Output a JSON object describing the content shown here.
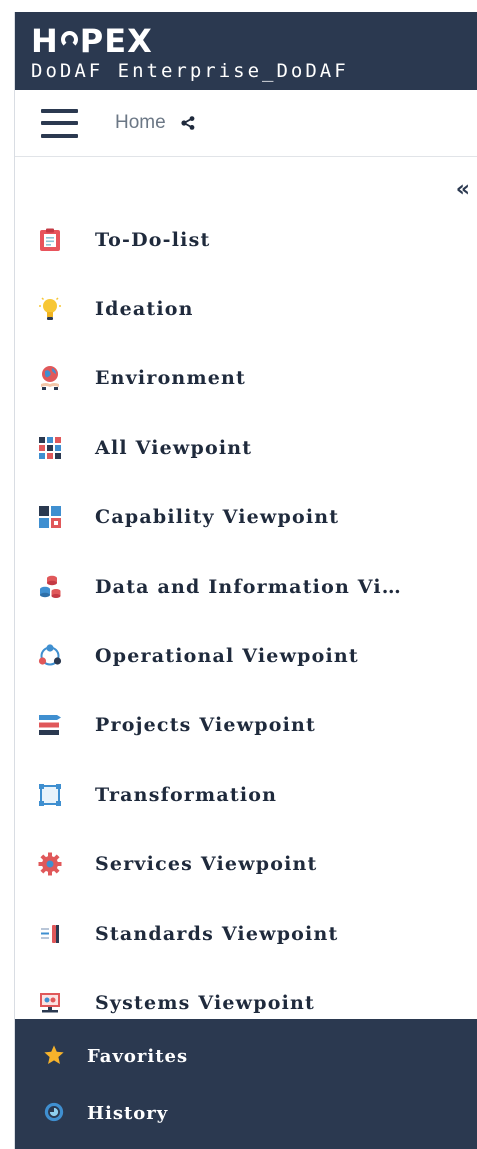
{
  "brand": {
    "logo_part1": "H",
    "logo_part2": "PEX",
    "environment": "DoDAF Enterprise_DoDAF"
  },
  "toolbar": {
    "home_label": "Home",
    "collapse_glyph": "«"
  },
  "nav": {
    "items": [
      {
        "label": "To-Do-list",
        "icon": "todo-list-icon"
      },
      {
        "label": "Ideation",
        "icon": "lightbulb-icon"
      },
      {
        "label": "Environment",
        "icon": "globe-hand-icon"
      },
      {
        "label": "All Viewpoint",
        "icon": "grid-tiles-icon"
      },
      {
        "label": "Capability Viewpoint",
        "icon": "capability-blocks-icon"
      },
      {
        "label": "Data and Information Vi…",
        "icon": "database-icon"
      },
      {
        "label": "Operational Viewpoint",
        "icon": "network-nodes-icon"
      },
      {
        "label": "Projects Viewpoint",
        "icon": "project-bars-icon"
      },
      {
        "label": "Transformation",
        "icon": "transform-frame-icon"
      },
      {
        "label": "Services Viewpoint",
        "icon": "gear-icon"
      },
      {
        "label": "Standards Viewpoint",
        "icon": "document-rules-icon"
      },
      {
        "label": "Systems Viewpoint",
        "icon": "monitor-icon"
      }
    ]
  },
  "footer": {
    "favorites_label": "Favorites",
    "history_label": "History"
  },
  "colors": {
    "header_bg": "#2b3950",
    "text_dark": "#1f2a3c",
    "muted": "#6b7785"
  }
}
